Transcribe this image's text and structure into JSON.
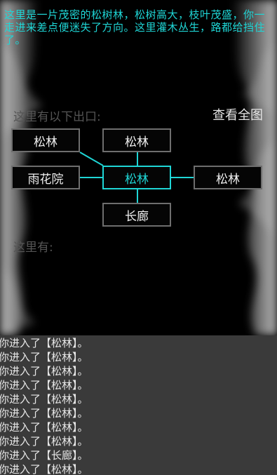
{
  "description": "这里是一片茂密的松树林，松树高大，枝叶茂盛，你一走进来差点便迷失了方向。这里灌木丛生，路都给挡住了。",
  "exits_label": "这里有以下出口:",
  "view_map_label": "查看全图",
  "rooms": {
    "north_west": "松林",
    "north": "松林",
    "west": "雨花院",
    "current": "松林",
    "east": "松林",
    "south": "长廊"
  },
  "here_label": "这里有:",
  "log": [
    "你进入了【松林】。",
    "你进入了【松林】。",
    "你进入了【松林】。",
    "你进入了【松林】。",
    "你进入了【松林】。",
    "你进入了【松林】。",
    "你进入了【松林】。",
    "你进入了【松林】。",
    "你进入了【长廊】。",
    "你进入了【松林】。"
  ],
  "colors": {
    "accent": "#1fd6d6",
    "room_border": "#6e6e6e",
    "log_bg": "#3a3a3a"
  }
}
